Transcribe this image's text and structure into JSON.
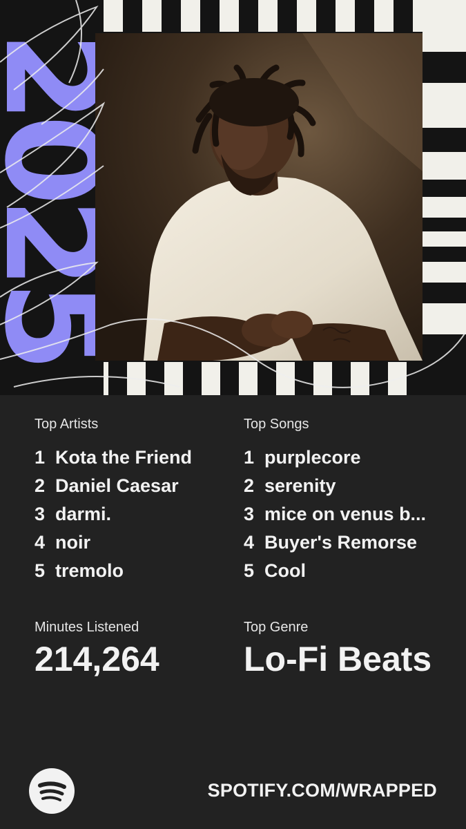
{
  "header": {
    "year": "2025"
  },
  "colors": {
    "background": "#222222",
    "accent_purple": "#8f8bf5",
    "stripe_light": "#f1f0ea",
    "stripe_dark": "#141414",
    "text": "#f2f2f2"
  },
  "artwork": {
    "photo_icon": "artist-photo"
  },
  "top_artists": {
    "label": "Top Artists",
    "items": [
      {
        "rank": "1",
        "name": "Kota the Friend"
      },
      {
        "rank": "2",
        "name": "Daniel Caesar"
      },
      {
        "rank": "3",
        "name": "darmi."
      },
      {
        "rank": "4",
        "name": "noir"
      },
      {
        "rank": "5",
        "name": "tremolo"
      }
    ]
  },
  "top_songs": {
    "label": "Top Songs",
    "items": [
      {
        "rank": "1",
        "name": "purplecore"
      },
      {
        "rank": "2",
        "name": "serenity"
      },
      {
        "rank": "3",
        "name": "mice on venus b..."
      },
      {
        "rank": "4",
        "name": "Buyer's Remorse"
      },
      {
        "rank": "5",
        "name": "Cool"
      }
    ]
  },
  "minutes": {
    "label": "Minutes Listened",
    "value": "214,264"
  },
  "genre": {
    "label": "Top Genre",
    "value": "Lo-Fi Beats"
  },
  "footer": {
    "logo_icon": "spotify-logo-icon",
    "link": "SPOTIFY.COM/WRAPPED"
  }
}
